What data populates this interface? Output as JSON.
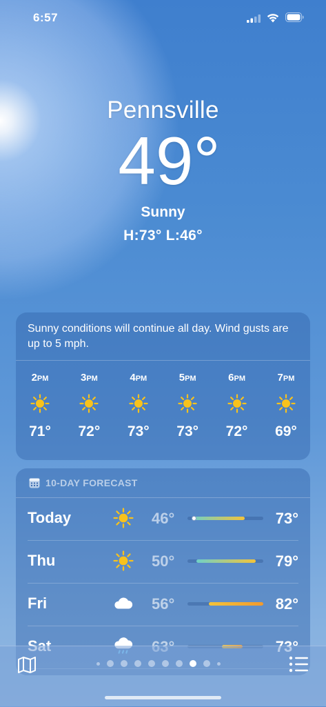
{
  "status": {
    "time": "6:57"
  },
  "hero": {
    "city": "Pennsville",
    "temperature": "49°",
    "condition": "Sunny",
    "high_low": "H:73°  L:46°"
  },
  "hourly": {
    "summary": "Sunny conditions will continue all day. Wind gusts are up to 5 mph.",
    "hours": [
      {
        "hour": "2",
        "suffix": "PM",
        "icon": "sun-icon",
        "temp": "71°"
      },
      {
        "hour": "3",
        "suffix": "PM",
        "icon": "sun-icon",
        "temp": "72°"
      },
      {
        "hour": "4",
        "suffix": "PM",
        "icon": "sun-icon",
        "temp": "73°"
      },
      {
        "hour": "5",
        "suffix": "PM",
        "icon": "sun-icon",
        "temp": "73°"
      },
      {
        "hour": "6",
        "suffix": "PM",
        "icon": "sun-icon",
        "temp": "72°"
      },
      {
        "hour": "7",
        "suffix": "PM",
        "icon": "sun-icon",
        "temp": "69°"
      }
    ]
  },
  "forecast": {
    "header": "10-DAY FORECAST",
    "days": [
      {
        "day": "Today",
        "icon": "sun-icon",
        "low": "46°",
        "high": "73°",
        "range_start": 0.05,
        "range_end": 0.75,
        "current": 0.08
      },
      {
        "day": "Thu",
        "icon": "sun-icon",
        "low": "50°",
        "high": "79°",
        "range_start": 0.12,
        "range_end": 0.9
      },
      {
        "day": "Fri",
        "icon": "cloud-icon",
        "low": "56°",
        "high": "82°",
        "range_start": 0.28,
        "range_end": 1.0
      },
      {
        "day": "Sat",
        "icon": "cloud-rain-icon",
        "low": "63°",
        "high": "73°",
        "range_start": 0.45,
        "range_end": 0.73
      }
    ]
  },
  "colors": {
    "sun": "#f8c21c",
    "bar_cool": "#6fd0c8",
    "bar_warm": "#f3c33a",
    "bar_hot": "#f29a2e"
  },
  "pager": {
    "pages": 10,
    "active_index": 7
  }
}
